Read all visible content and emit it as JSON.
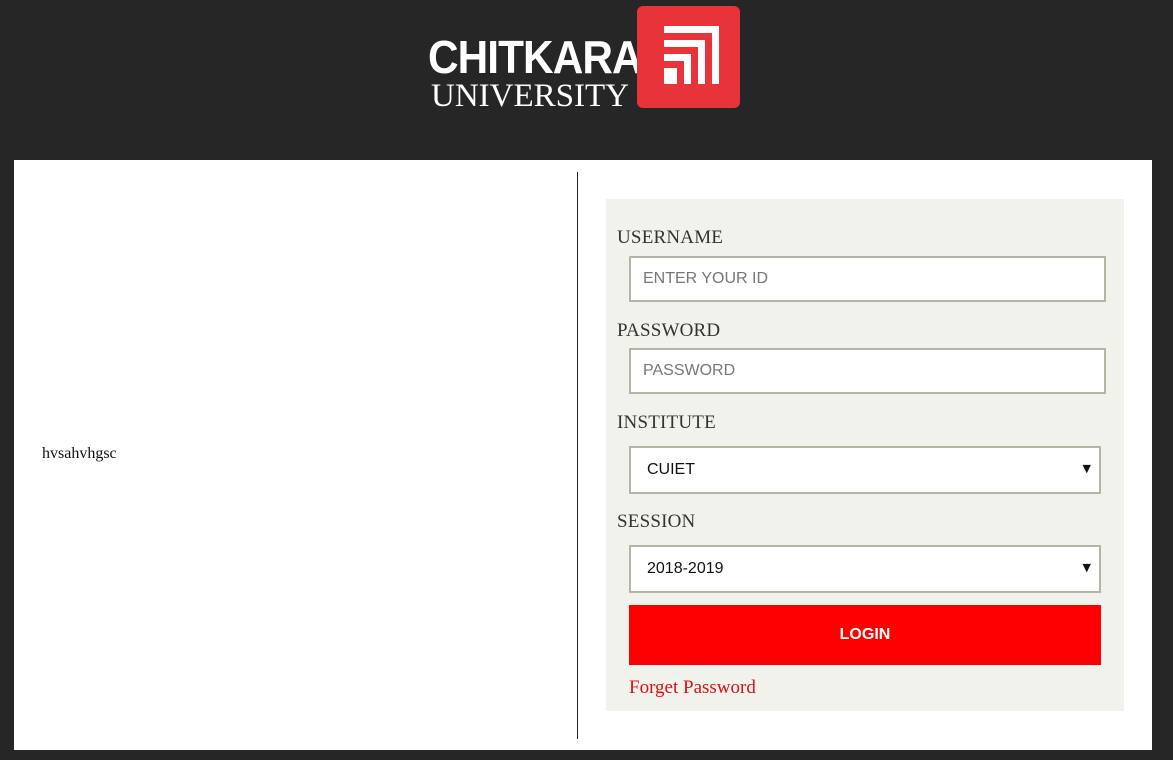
{
  "header": {
    "logo": {
      "line1": "CHITKARA",
      "line2": "UNIVERSITY",
      "mark_color": "#e8333a"
    }
  },
  "left_pane": {
    "notice_text": "hvsahvhgsc"
  },
  "login_form": {
    "username_label": "USERNAME",
    "username_placeholder": "ENTER YOUR ID",
    "username_value": "",
    "password_label": "PASSWORD",
    "password_placeholder": "PASSWORD",
    "password_value": "",
    "institute_label": "INSTITUTE",
    "institute_selected": "CUIET",
    "session_label": "SESSION",
    "session_selected": "2018-2019",
    "login_button_label": "LOGIN",
    "forgot_password_label": "Forget Password"
  },
  "colors": {
    "page_background": "#262626",
    "panel_background": "#f2f2ec",
    "login_button": "#ff0000",
    "link": "#e01010"
  },
  "icons": {
    "dropdown_arrow": "chevron-down-icon"
  }
}
